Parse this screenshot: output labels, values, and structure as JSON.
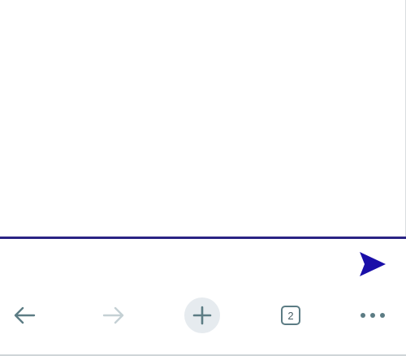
{
  "composer": {
    "send_icon": "send-icon"
  },
  "toolbar": {
    "back_icon": "arrow-left-icon",
    "forward_icon": "arrow-right-icon",
    "new_tab_icon": "plus-icon",
    "tab_count": "2",
    "more_icon": "ellipsis-icon"
  },
  "colors": {
    "accent": "#1a0fa8",
    "divider": "#2a2384",
    "icon": "#5c7c84",
    "icon_disabled": "#c4d0d4",
    "new_tab_bg": "#e6ebef"
  }
}
